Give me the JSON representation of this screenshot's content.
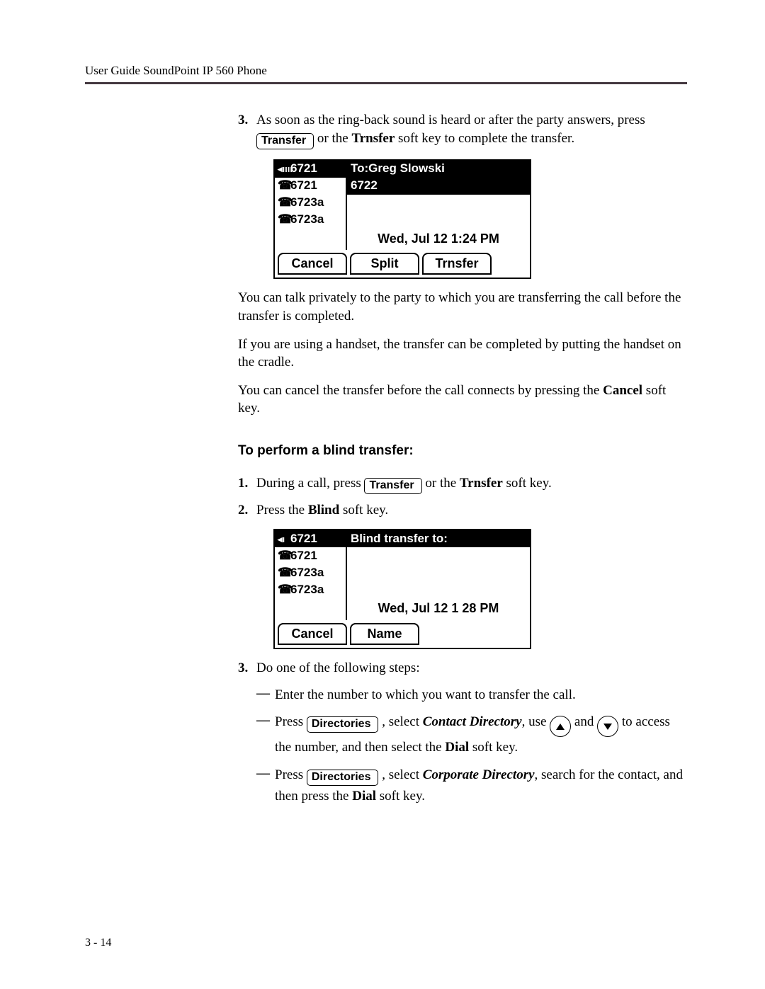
{
  "header": "User Guide SoundPoint IP 560 Phone",
  "page_number": "3 - 14",
  "step3a": {
    "num": "3.",
    "line1": "As soon as the ring-back sound is heard or after the party answers, press",
    "key": "Transfer",
    "line2_pre": " or the ",
    "line2_bold": "Trnsfer",
    "line2_post": " soft key to complete the transfer."
  },
  "screen1": {
    "left": [
      {
        "icon": "◂ıııı",
        "text": "6721",
        "sel": true
      },
      {
        "icon": "☎",
        "text": "6721",
        "sel": false
      },
      {
        "icon": "☎",
        "text": "6723a",
        "sel": false
      },
      {
        "icon": "☎",
        "text": "6723a",
        "sel": false
      }
    ],
    "right_title": "To:Greg Slowski",
    "right_sub": "6722",
    "dt": "Wed, Jul 12  1:24 PM",
    "softkeys": [
      "Cancel",
      "Split",
      "Trnsfer"
    ]
  },
  "para1": "You can talk privately to the party to which you are transferring the call before the transfer is completed.",
  "para2": "If you are using a handset, the transfer can be completed by putting the handset on the cradle.",
  "para3_pre": "You can cancel the transfer before the call connects by pressing the ",
  "para3_bold": "Cancel",
  "para3_post": " soft key.",
  "heading": "To perform a blind transfer:",
  "b_step1": {
    "num": "1.",
    "pre": "During a call, press ",
    "key": "Transfer",
    "mid": " or the ",
    "bold": "Trnsfer",
    "post": " soft key."
  },
  "b_step2": {
    "num": "2.",
    "pre": "Press the ",
    "bold": "Blind",
    "post": " soft key."
  },
  "screen2": {
    "left": [
      {
        "icon": "◂ı",
        "text": "6721",
        "sel": true
      },
      {
        "icon": "☎",
        "text": "6721",
        "sel": false
      },
      {
        "icon": "☎",
        "text": "6723a",
        "sel": false
      },
      {
        "icon": "☎",
        "text": "6723a",
        "sel": false
      }
    ],
    "right_title": "Blind transfer to:",
    "dt": "Wed, Jul 12  1 28 PM",
    "softkeys": [
      "Cancel",
      "Name"
    ]
  },
  "b_step3": {
    "num": "3.",
    "text": "Do one of the following steps:"
  },
  "sub1": "Enter the number to which you want to transfer the call.",
  "sub2": {
    "pre": "Press ",
    "key": "Directories",
    "mid1": " , select ",
    "ital": "Contact Directory",
    "mid2": ", use ",
    "mid3": " and ",
    "mid4": " to access the number, and then select the ",
    "bold": "Dial",
    "post": " soft key."
  },
  "sub3": {
    "pre": "Press ",
    "key": "Directories",
    "mid1": " , select ",
    "ital": "Corporate Directory",
    "mid2": ", search for the contact, and then press the ",
    "bold": "Dial",
    "post": " soft key."
  }
}
